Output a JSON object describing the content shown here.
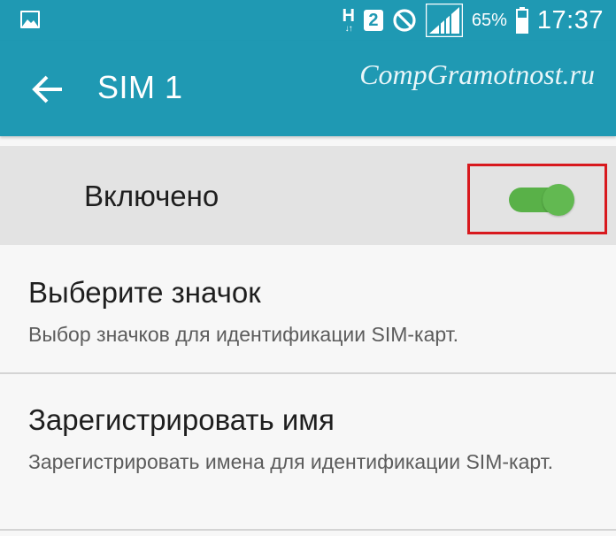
{
  "status_bar": {
    "network_letter": "H",
    "network_arrows": "↓↑",
    "sim_slot": "2",
    "battery_percent": "65%",
    "time": "17:37",
    "icons": [
      "gallery-icon",
      "mobile-data-icon",
      "sim-2-icon",
      "blocked-icon",
      "signal-icon",
      "battery-icon"
    ]
  },
  "app_bar": {
    "title": "SIM 1",
    "watermark": "CompGramotnost.ru",
    "back_icon": "back-arrow-icon"
  },
  "enabled_row": {
    "label": "Включено",
    "toggle_on": true
  },
  "settings": [
    {
      "title": "Выберите значок",
      "description": "Выбор значков для идентификации SIM-карт."
    },
    {
      "title": "Зарегистрировать имя",
      "description": "Зарегистрировать имена для идентификации SIM-карт."
    }
  ],
  "colors": {
    "primary": "#1f99b3",
    "toggle_on": "#59b148",
    "highlight_frame": "#d8191e",
    "row_background": "#e3e3e3",
    "page_background": "#f7f7f7"
  }
}
